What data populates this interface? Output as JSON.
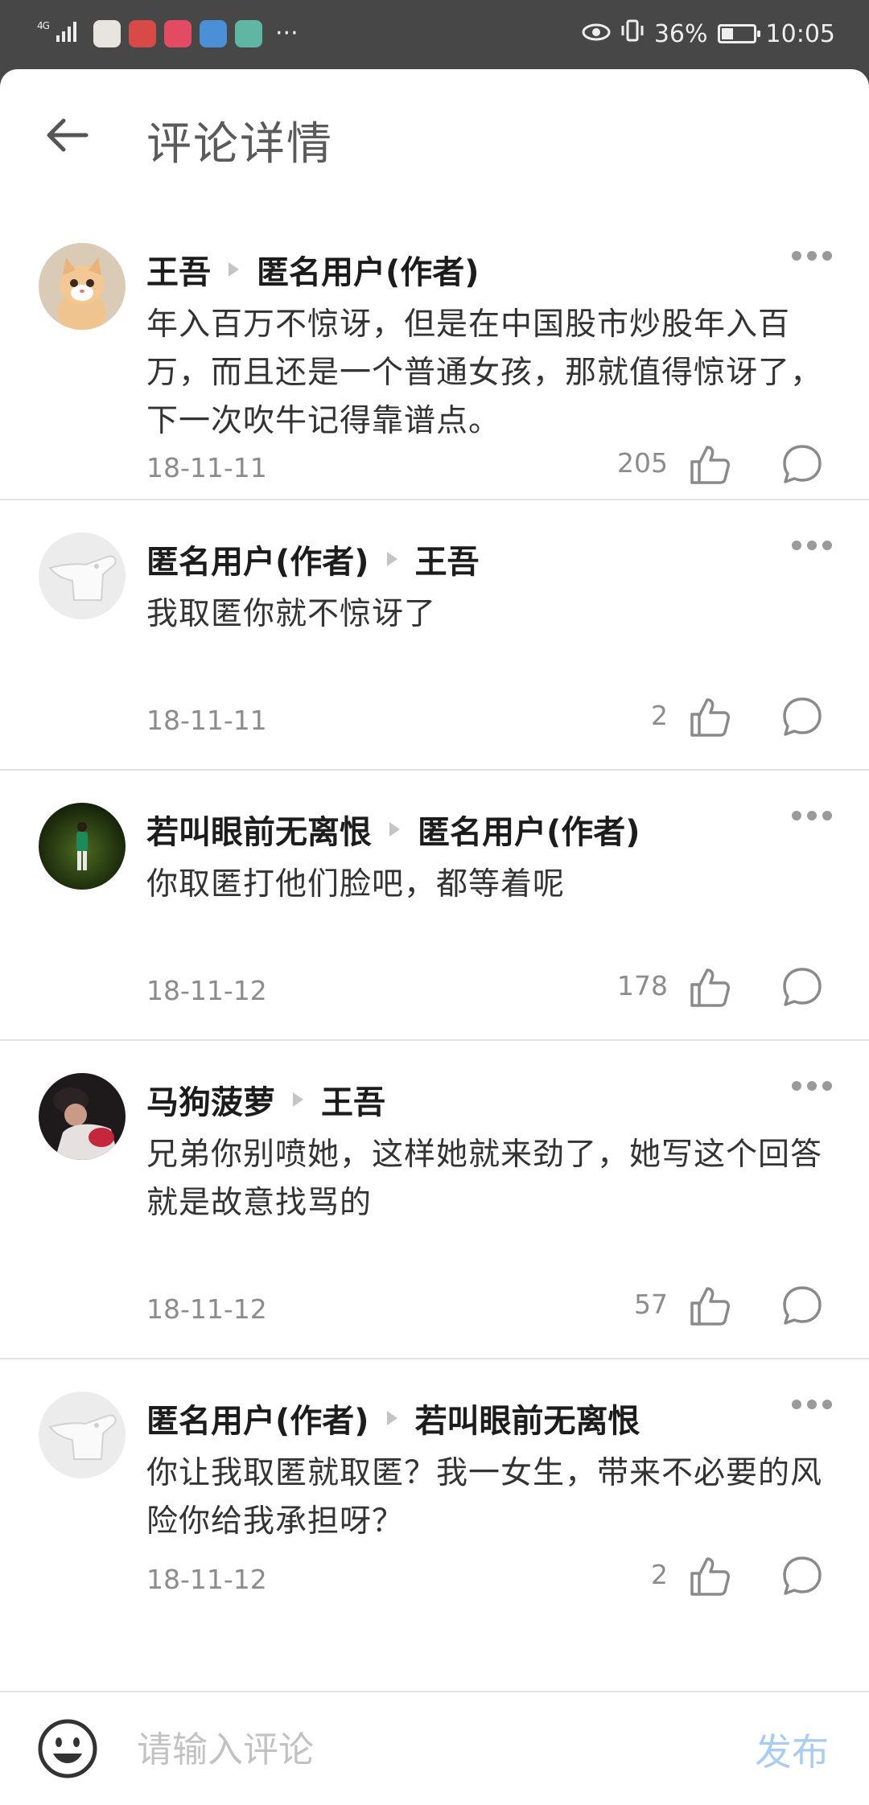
{
  "status_bar": {
    "network": "4G",
    "battery_text": "36%",
    "battery_level": 0.36,
    "time": "10:05",
    "more": "···",
    "app_icons": [
      {
        "name": "app-icon-1",
        "color": "#e8e4df"
      },
      {
        "name": "app-icon-2",
        "color": "#d84a46"
      },
      {
        "name": "app-icon-3",
        "color": "#e34b63"
      },
      {
        "name": "app-icon-4",
        "color": "#4b8fd6"
      },
      {
        "name": "app-icon-5",
        "color": "#5fb7a3"
      }
    ]
  },
  "header": {
    "title": "评论详情",
    "back_icon": "arrow-left-icon"
  },
  "comments": [
    {
      "author": "王吾",
      "reply_to": "匿名用户(作者)",
      "text": "年入百万不惊讶，但是在中国股市炒股年入百万，而且还是一个普通女孩，那就值得惊讶了，下一次吹牛记得靠谱点。",
      "date": "18-11-11",
      "likes": "205",
      "avatar": "kitten"
    },
    {
      "author": "匿名用户(作者)",
      "reply_to": "王吾",
      "text": "我取匿你就不惊讶了",
      "date": "18-11-11",
      "likes": "2",
      "avatar": "anonymous"
    },
    {
      "author": "若叫眼前无离恨",
      "reply_to": "匿名用户(作者)",
      "text": "你取匿打他们脸吧，都等着呢",
      "date": "18-11-12",
      "likes": "178",
      "avatar": "footballer"
    },
    {
      "author": "马狗菠萝",
      "reply_to": "王吾",
      "text": "兄弟你别喷她，这样她就来劲了，她写这个回答就是故意找骂的",
      "date": "18-11-12",
      "likes": "57",
      "avatar": "person"
    },
    {
      "author": "匿名用户(作者)",
      "reply_to": "若叫眼前无离恨",
      "text": "你让我取匿就取匿？我一女生，带来不必要的风险你给我承担呀？",
      "date": "18-11-12",
      "likes": "2",
      "avatar": "anonymous"
    }
  ],
  "input_bar": {
    "placeholder": "请输入评论",
    "publish_label": "发布",
    "emoji_icon": "smiley-icon"
  },
  "colors": {
    "status_bar_bg": "#474747",
    "publish_disabled": "#a9cdf0",
    "divider": "#e3e3e3"
  }
}
